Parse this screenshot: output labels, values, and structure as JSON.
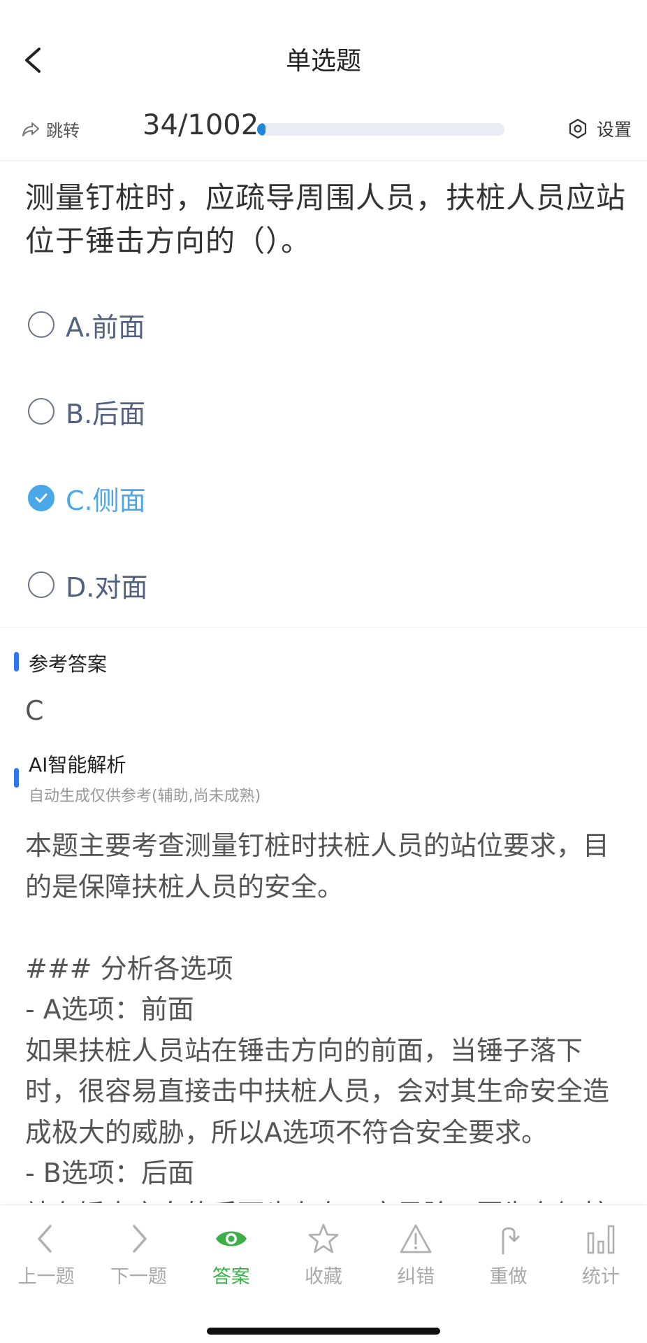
{
  "header": {
    "title": "单选题"
  },
  "toolbar": {
    "jump_label": "跳转",
    "progress_text": "34/1002",
    "progress_fraction": 0.034,
    "settings_label": "设置"
  },
  "question": {
    "text": "测量钉桩时，应疏导周围人员，扶桩人员应站位于锤击方向的（）。",
    "options": [
      {
        "label": "A.前面",
        "selected": false
      },
      {
        "label": "B.后面",
        "selected": false
      },
      {
        "label": "C.侧面",
        "selected": true
      },
      {
        "label": "D.对面",
        "selected": false
      }
    ]
  },
  "reference": {
    "title": "参考答案",
    "answer": "C"
  },
  "ai_analysis": {
    "title": "AI智能解析",
    "subtitle": "自动生成仅供参考(辅助,尚未成熟)",
    "body": "本题主要考查测量钉桩时扶桩人员的站位要求，目的是保障扶桩人员的安全。\n\n### 分析各选项\n- A选项：前面\n如果扶桩人员站在锤击方向的前面，当锤子落下时，很容易直接击中扶桩人员，会对其生命安全造成极大的威胁，所以A选项不符合安全要求。\n- B选项：后面\n站在锤击方向的后面也存在一定风险，因为在钉桩"
  },
  "bottom_nav": {
    "items": [
      {
        "label": "上一题",
        "icon": "chevron-left-icon"
      },
      {
        "label": "下一题",
        "icon": "chevron-right-icon"
      },
      {
        "label": "答案",
        "icon": "eye-icon",
        "active": true
      },
      {
        "label": "收藏",
        "icon": "star-icon"
      },
      {
        "label": "纠错",
        "icon": "warning-icon"
      },
      {
        "label": "重做",
        "icon": "redo-icon"
      },
      {
        "label": "统计",
        "icon": "bar-chart-icon"
      }
    ]
  },
  "colors": {
    "accent_blue": "#4aa8e8",
    "active_green": "#3cae4a",
    "section_bar": "#2f74f0"
  }
}
